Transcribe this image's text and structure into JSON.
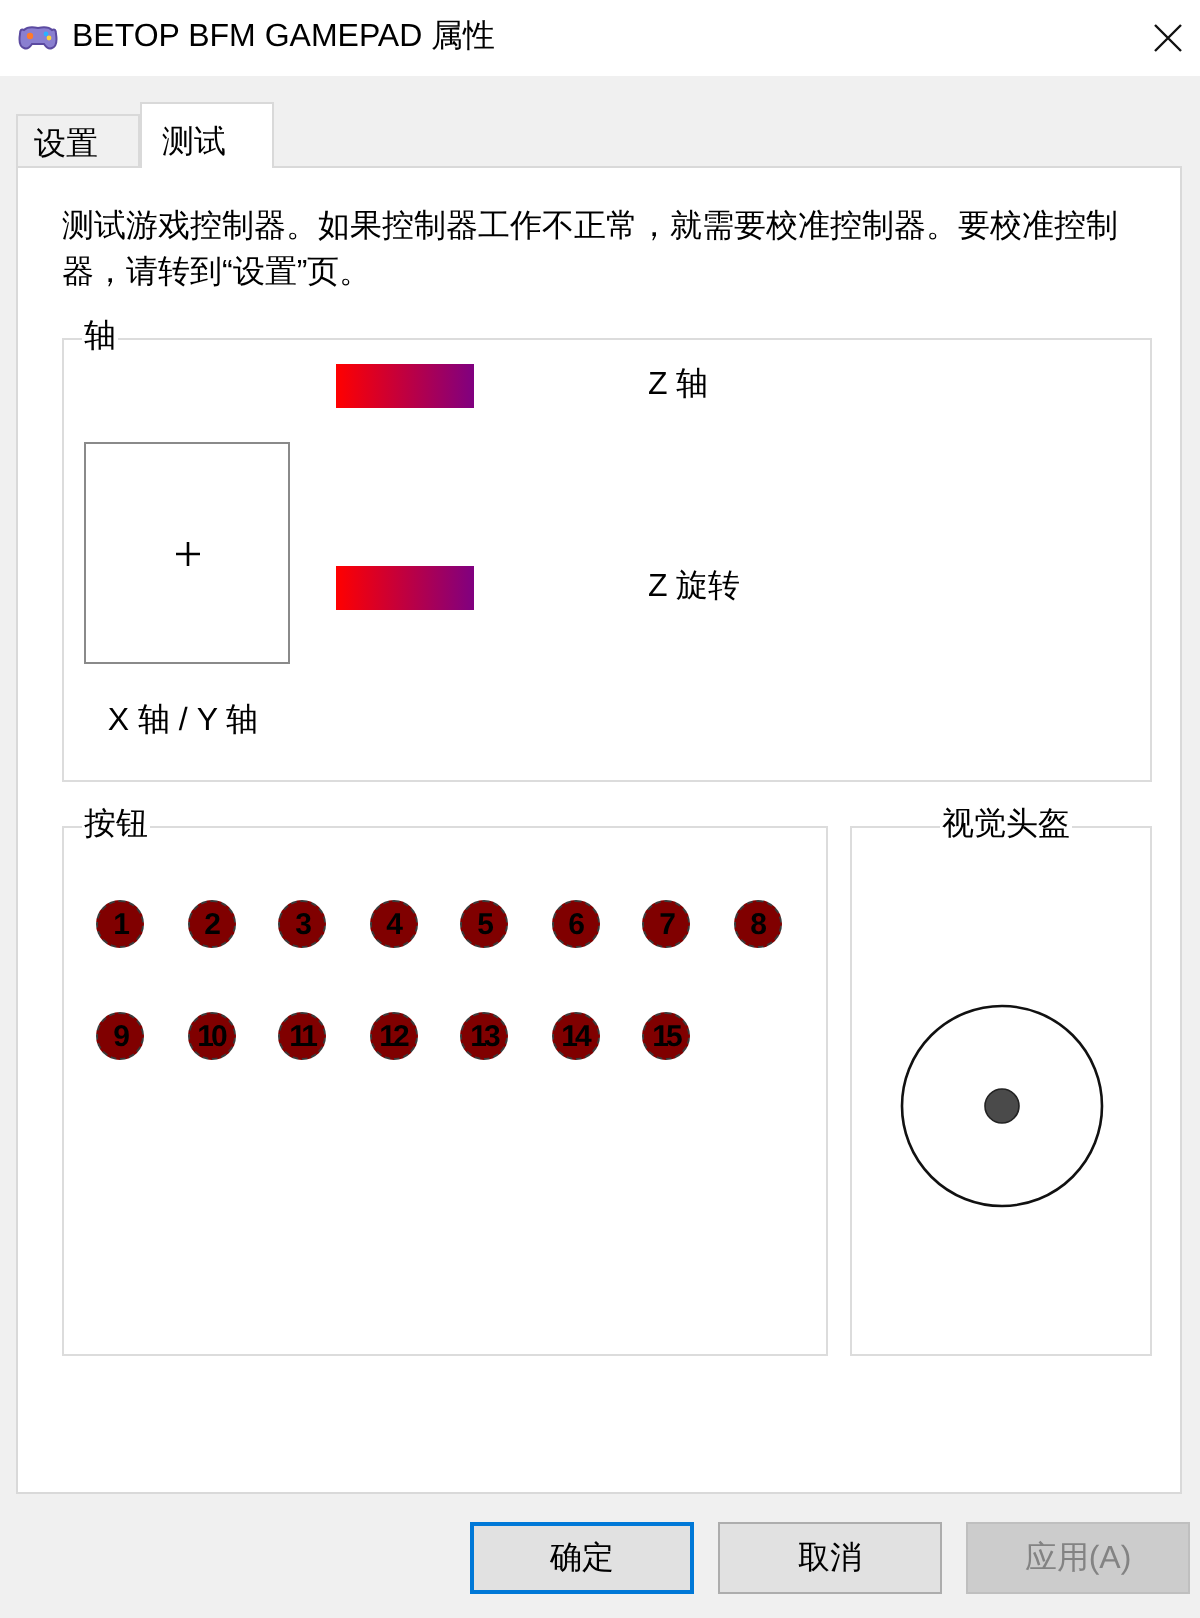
{
  "window": {
    "title": "BETOP BFM GAMEPAD 属性"
  },
  "tabs": [
    {
      "label": "设置",
      "selected": false
    },
    {
      "label": "测试",
      "selected": true
    }
  ],
  "description": "测试游戏控制器。如果控制器工作不正常，就需要校准控制器。要校准控制器，请转到“设置”页。",
  "axes": {
    "title": "轴",
    "xy_label": "X 轴 / Y 轴",
    "meters": [
      {
        "label": "Z 轴"
      },
      {
        "label": "Z 旋转"
      }
    ]
  },
  "buttons_group": {
    "title": "按钮",
    "buttons": [
      {
        "label": "1",
        "pressed": false
      },
      {
        "label": "2",
        "pressed": false
      },
      {
        "label": "3",
        "pressed": false
      },
      {
        "label": "4",
        "pressed": false
      },
      {
        "label": "5",
        "pressed": false
      },
      {
        "label": "6",
        "pressed": false
      },
      {
        "label": "7",
        "pressed": false
      },
      {
        "label": "8",
        "pressed": false
      },
      {
        "label": "9",
        "pressed": false
      },
      {
        "label": "10",
        "pressed": false
      },
      {
        "label": "11",
        "pressed": false
      },
      {
        "label": "12",
        "pressed": false
      },
      {
        "label": "13",
        "pressed": false
      },
      {
        "label": "14",
        "pressed": false
      },
      {
        "label": "15",
        "pressed": false
      }
    ]
  },
  "pov": {
    "title": "视觉头盔"
  },
  "dialog_buttons": [
    {
      "label": "确定",
      "default": true,
      "disabled": false
    },
    {
      "label": "取消",
      "default": false,
      "disabled": false
    },
    {
      "label": "应用(A)",
      "default": false,
      "disabled": true
    }
  ]
}
